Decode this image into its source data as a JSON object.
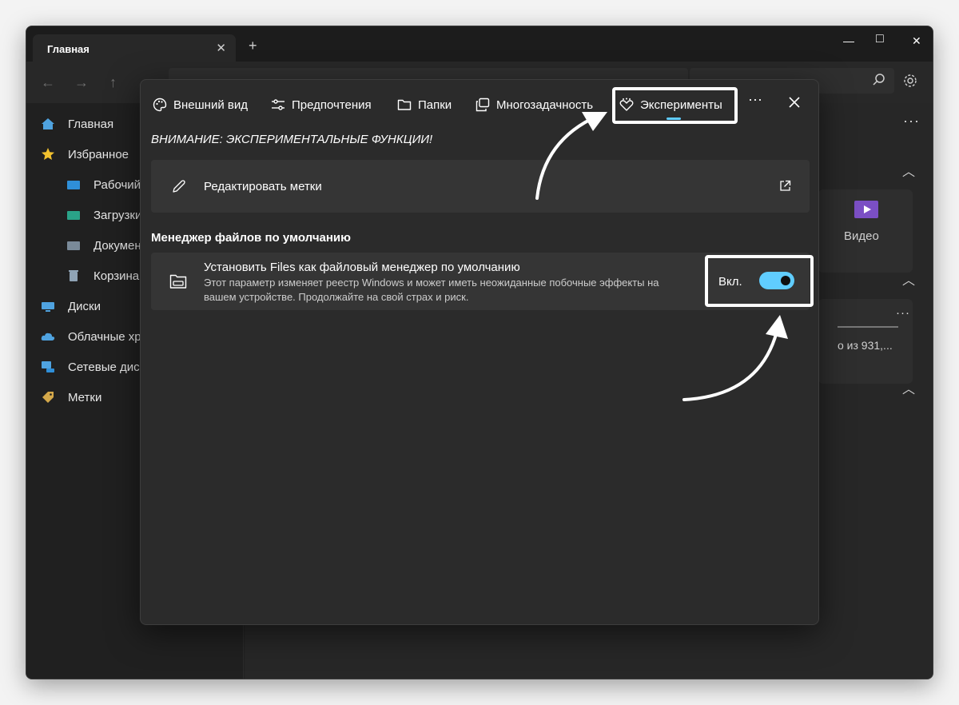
{
  "window": {
    "tab_title": "Главная",
    "tab_close": "✕",
    "new_tab": "+",
    "controls": {
      "minimize": "—",
      "maximize": "□",
      "close": "✕"
    }
  },
  "toolbar": {
    "back": "←",
    "forward": "→",
    "up": "↑"
  },
  "sidebar": {
    "items": [
      {
        "label": "Главная",
        "icon": "home-icon",
        "color": "#4fa3e0"
      },
      {
        "label": "Избранное",
        "icon": "star-icon",
        "color": "#f2c12e"
      },
      {
        "label": "Рабочий стол",
        "icon": "desktop-folder-icon",
        "color": "#2f8fd8"
      },
      {
        "label": "Загрузки",
        "icon": "downloads-folder-icon",
        "color": "#2aa388"
      },
      {
        "label": "Документы",
        "icon": "documents-folder-icon",
        "color": "#7a8a99"
      },
      {
        "label": "Корзина",
        "icon": "recycle-bin-icon",
        "color": "#8fa3b5"
      },
      {
        "label": "Диски",
        "icon": "drive-icon",
        "color": "#4fa3e0"
      },
      {
        "label": "Облачные хранилища",
        "icon": "cloud-icon",
        "color": "#4fa3e0"
      },
      {
        "label": "Сетевые диски",
        "icon": "network-icon",
        "color": "#4fa3e0"
      },
      {
        "label": "Метки",
        "icon": "tag-icon",
        "color": "#d4a84a"
      }
    ]
  },
  "content": {
    "more_dots": "···",
    "video_label": "Видео",
    "card_dots": "···",
    "drive_info": "о из 931,..."
  },
  "dialog": {
    "tabs": [
      {
        "label": "Внешний вид",
        "icon": "palette-icon"
      },
      {
        "label": "Предпочтения",
        "icon": "sliders-icon"
      },
      {
        "label": "Папки",
        "icon": "folder-icon"
      },
      {
        "label": "Многозадачность",
        "icon": "multitask-icon"
      },
      {
        "label": "Эксперименты",
        "icon": "flask-icon",
        "active": true
      }
    ],
    "more": "···",
    "warning": "ВНИМАНИЕ: ЭКСПЕРИМЕНТАЛЬНЫЕ ФУНКЦИИ!",
    "edit_tags": {
      "label": "Редактировать метки",
      "icon": "pencil-icon",
      "action_icon": "open-external-icon"
    },
    "section_title": "Менеджер файлов по умолчанию",
    "default_manager": {
      "title": "Установить Files как файловый менеджер по умолчанию",
      "description_line1": "Этот параметр изменяет реестр Windows и может иметь неожиданные побочные эффекты на",
      "description_line2": "вашем устройстве. Продолжайте на свой страх и риск.",
      "toggle_label": "Вкл.",
      "toggle_on": true,
      "icon": "folder-drive-icon"
    },
    "accent_color": "#60cdff"
  }
}
